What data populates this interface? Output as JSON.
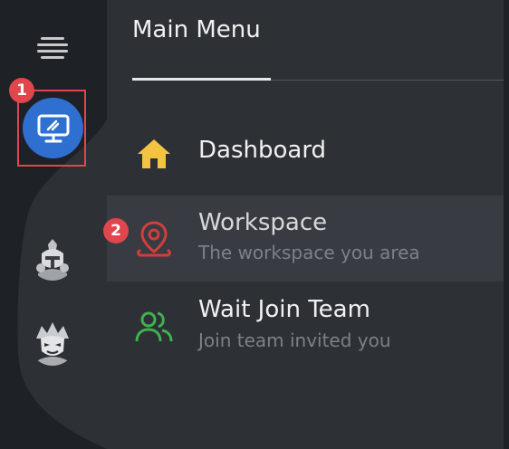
{
  "sidebar": {
    "menu_icon": "hamburger-icon",
    "selected_workspace_icon": "monitor-icon",
    "avatars": [
      {
        "name": "knight-avatar"
      },
      {
        "name": "samurai-avatar"
      }
    ],
    "annotations": [
      "1",
      "2"
    ]
  },
  "menu": {
    "title": "Main Menu",
    "items": [
      {
        "label": "Dashboard",
        "subtitle": "",
        "icon": "home-icon",
        "color": "#f5c342"
      },
      {
        "label": "Workspace",
        "subtitle": "The workspace you area",
        "icon": "map-pin-icon",
        "color": "#d13f3a"
      },
      {
        "label": "Wait Join Team",
        "subtitle": "Join team invited you",
        "icon": "users-icon",
        "color": "#3fb24f"
      }
    ]
  },
  "colors": {
    "accent": "#2f6fd0",
    "annotation_red": "#e0464b",
    "panel_bg": "#2d3035",
    "rail_bg": "#1e2125"
  }
}
